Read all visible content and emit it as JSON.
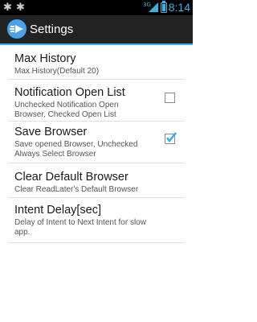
{
  "status_bar": {
    "network": "3G",
    "time": "8:14",
    "notification_icons": [
      "asterisk-icon",
      "asterisk-icon"
    ]
  },
  "action_bar": {
    "title": "Settings",
    "app_icon": "app-launcher-arrow-icon"
  },
  "preferences": [
    {
      "title": "Max History",
      "summary": "Max History(Default 20)"
    },
    {
      "title": "Notification Open List",
      "summary_lines": [
        "Unchecked Notification Open",
        "Browser, Checked Open List"
      ],
      "checked": false
    },
    {
      "title": "Save Browser",
      "summary_lines": [
        "Save opened Browser, Unchecked",
        "Always Select Browser"
      ],
      "checked": true
    },
    {
      "title": "Clear Default Browser",
      "summary": "Clear ReadLater's Default Browser"
    },
    {
      "title": "Intent Delay[sec]",
      "summary_lines": [
        "Delay of Intent to Next Intent for slow",
        "app."
      ]
    }
  ],
  "colors": {
    "accent": "#33b5e5",
    "action_bar": "#222222",
    "checkmark": "#33b5e5"
  }
}
